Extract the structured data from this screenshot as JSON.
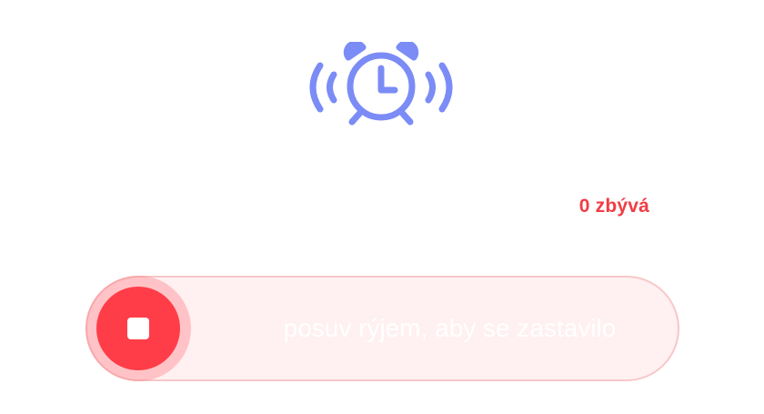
{
  "alarm": {
    "icon": "alarm-clock-ringing-icon",
    "remaining_label": "0 zbývá",
    "slider_hint": "posuv rýjem, aby se zastavilo",
    "handle_icon": "stop-icon",
    "slider_position": 0
  },
  "colors": {
    "icon": "#7b8cf6",
    "accent": "#ff3d48",
    "remaining_text": "#f23c44",
    "track_fill": "#fff0f1",
    "track_border": "#f8c7c9"
  }
}
